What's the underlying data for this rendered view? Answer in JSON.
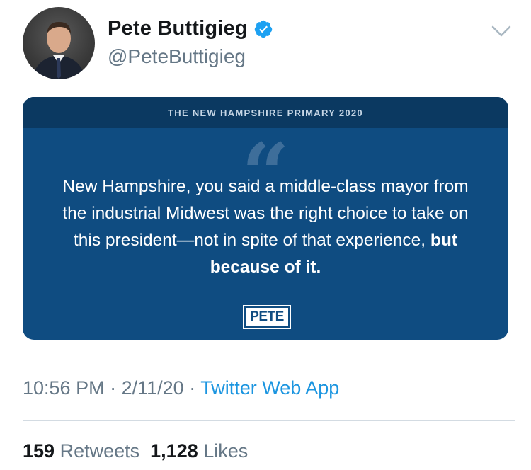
{
  "author": {
    "display_name": "Pete Buttigieg",
    "handle": "@PeteButtigieg",
    "verified_icon": "verified-badge-icon"
  },
  "menu": {
    "icon": "chevron-down-icon"
  },
  "card": {
    "header": "THE NEW HAMPSHIRE PRIMARY 2020",
    "quote_mark": "“",
    "quote_text": "New Hampshire, you said a middle-class mayor from the industrial Midwest was the right choice to take on this president—not in spite of that experience,",
    "quote_emphasis": "but because of it.",
    "logo_text": "PETE",
    "colors": {
      "background": "#0f4c81",
      "header": "#0b3961"
    }
  },
  "meta": {
    "time": "10:56 PM",
    "separator": "·",
    "date": "2/11/20",
    "source": "Twitter Web App"
  },
  "stats": {
    "retweets_count": "159",
    "retweets_label": "Retweets",
    "likes_count": "1,128",
    "likes_label": "Likes"
  }
}
